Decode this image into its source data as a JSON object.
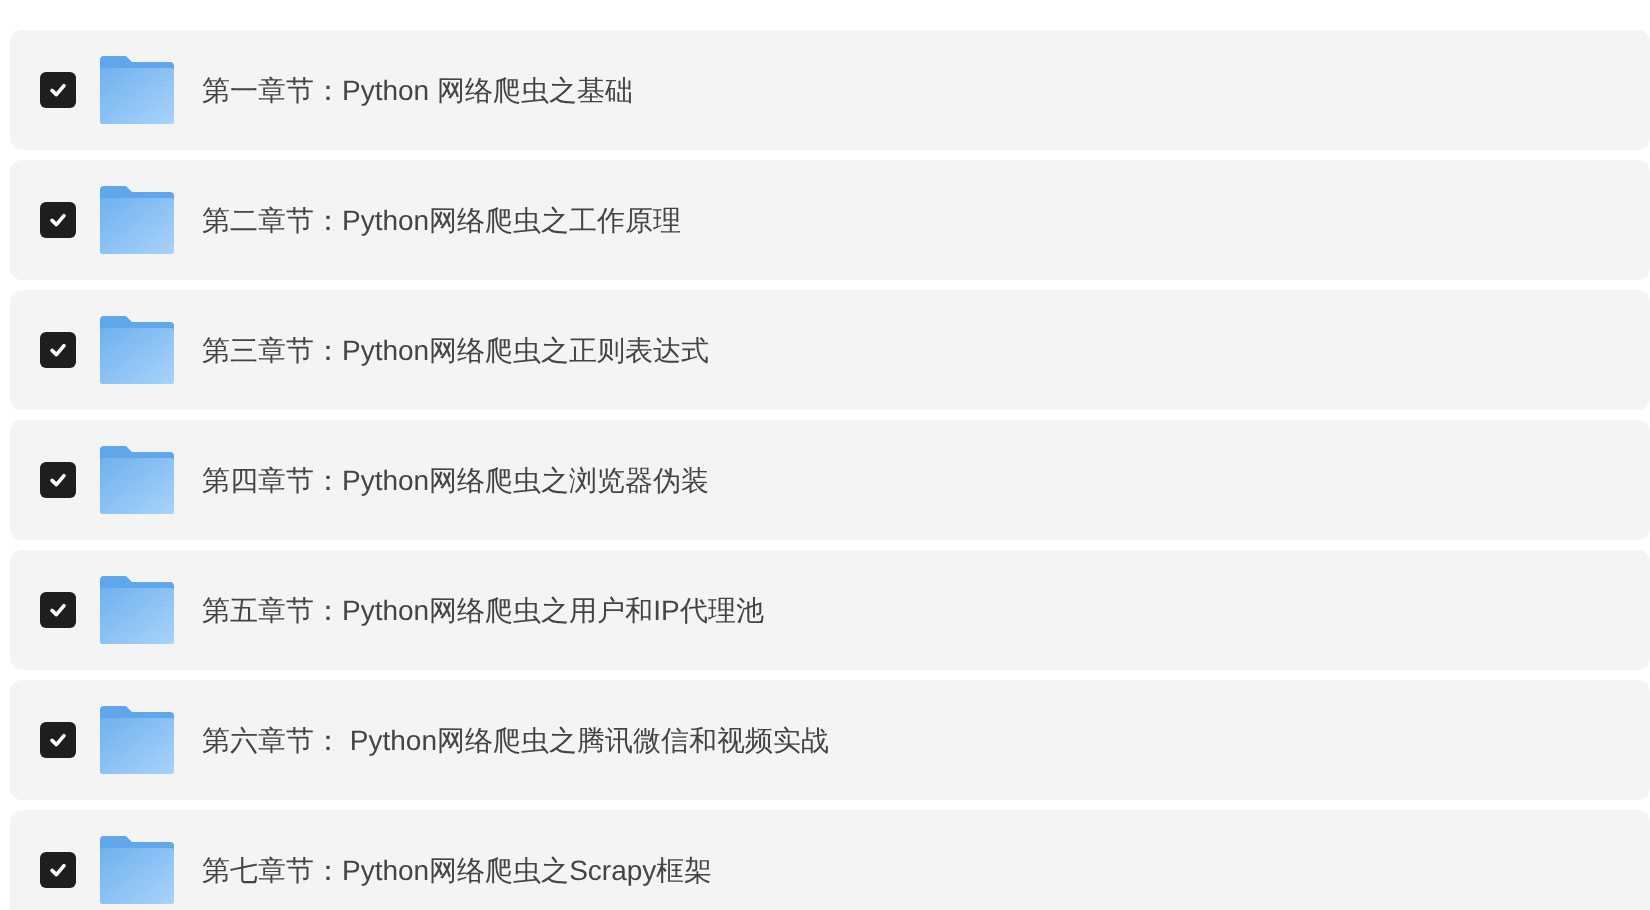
{
  "files": [
    {
      "name": "第一章节：Python 网络爬虫之基础",
      "checked": true
    },
    {
      "name": "第二章节：Python网络爬虫之工作原理",
      "checked": true
    },
    {
      "name": "第三章节：Python网络爬虫之正则表达式",
      "checked": true
    },
    {
      "name": "第四章节：Python网络爬虫之浏览器伪装",
      "checked": true
    },
    {
      "name": "第五章节：Python网络爬虫之用户和IP代理池",
      "checked": true
    },
    {
      "name": "第六章节： Python网络爬虫之腾讯微信和视频实战",
      "checked": true
    },
    {
      "name": "第七章节：Python网络爬虫之Scrapy框架",
      "checked": true
    }
  ]
}
